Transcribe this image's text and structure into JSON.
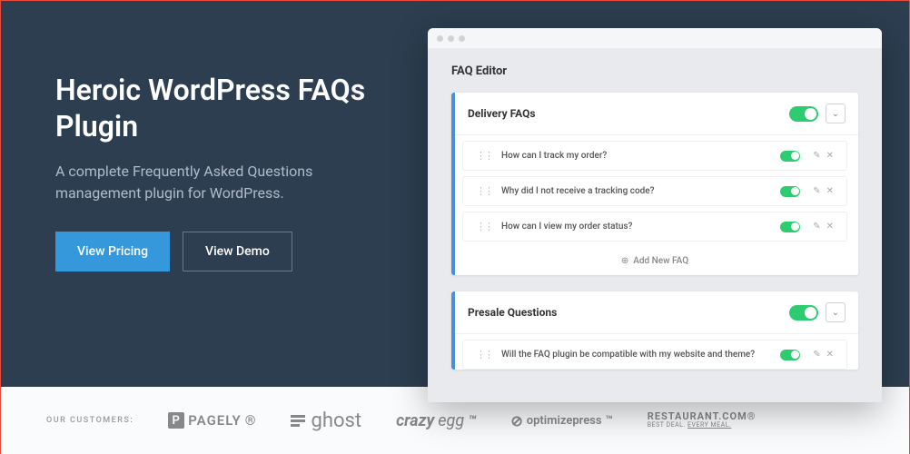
{
  "hero": {
    "title": "Heroic WordPress FAQs Plugin",
    "subtitle": "A complete Frequently Asked Questions management plugin for WordPress.",
    "primary_btn": "View Pricing",
    "secondary_btn": "View Demo"
  },
  "editor": {
    "title": "FAQ Editor",
    "groups": [
      {
        "title": "Delivery FAQs",
        "items": [
          "How can I track my order?",
          "Why did I not receive a tracking code?",
          "How can I view my order status?"
        ],
        "add_label": "Add New FAQ"
      },
      {
        "title": "Presale Questions",
        "items": [
          "Will the FAQ plugin be compatible with my website and theme?"
        ]
      }
    ]
  },
  "customers": {
    "label": "OUR CUSTOMERS:",
    "logos": {
      "pagely": "PAGELY",
      "ghost": "ghost",
      "crazyegg_a": "crazy",
      "crazyegg_b": "egg",
      "optimizepress": "optimizepress",
      "restaurant_a": "RESTAURANT.COM",
      "restaurant_b": "BEST DEAL. ",
      "restaurant_c": "EVERY MEAL."
    }
  }
}
